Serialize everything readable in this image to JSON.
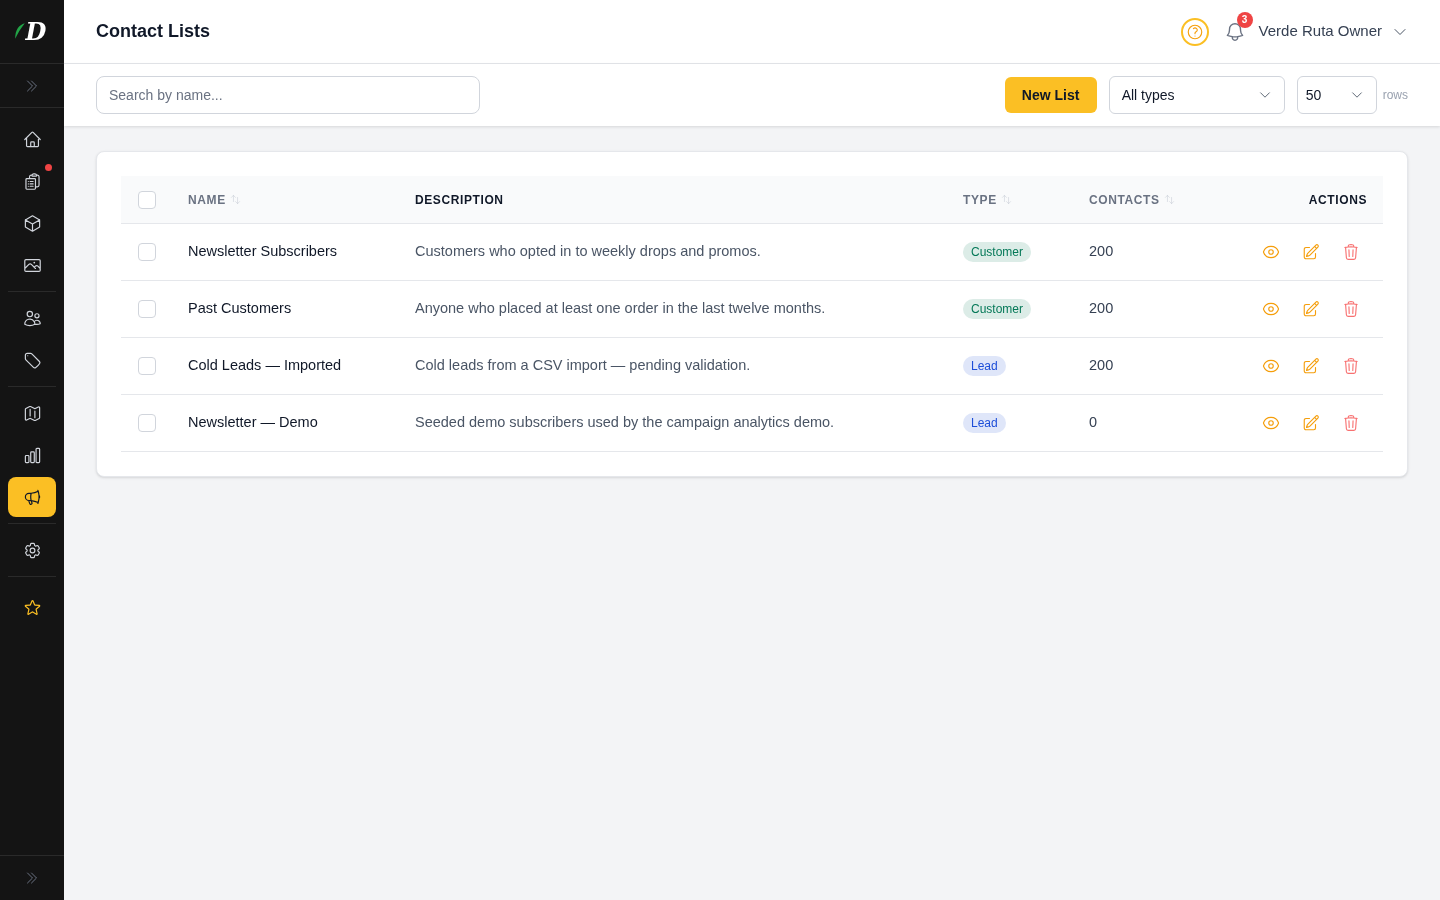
{
  "sidebar": {
    "logo": {
      "text": "D"
    },
    "groups": [
      [
        {
          "selected": false,
          "alert": false
        },
        {
          "selected": false,
          "alert": true
        },
        {
          "selected": false,
          "alert": false
        },
        {
          "selected": false,
          "alert": false
        }
      ],
      [
        {
          "selected": false,
          "alert": false
        },
        {
          "selected": false,
          "alert": false
        }
      ],
      [
        {
          "selected": false,
          "alert": false
        },
        {
          "selected": false,
          "alert": false
        },
        {
          "selected": true,
          "alert": false
        }
      ],
      [
        {
          "selected": false,
          "alert": false
        }
      ],
      [
        {
          "selected": false,
          "alert": false
        }
      ]
    ]
  },
  "header": {
    "title": "Contact Lists",
    "notifications": "3",
    "user": "Verde Ruta Owner"
  },
  "toolbar": {
    "search": {
      "placeholder": "Search by name..."
    },
    "new_button": "New List",
    "type_filter": {
      "value": "All types"
    },
    "page_size": {
      "value": "50"
    },
    "page_size_label": "rows"
  },
  "table": {
    "select_all": {
      "checked": false
    },
    "columns": [
      {
        "label": "NAME",
        "sortable": true
      },
      {
        "label": "DESCRIPTION",
        "sortable": false
      },
      {
        "label": "TYPE",
        "sortable": true
      },
      {
        "label": "CONTACTS",
        "sortable": true
      },
      {
        "label": "ACTIONS",
        "sortable": false
      }
    ],
    "rows": [
      {
        "checked": false,
        "name": "Newsletter Subscribers",
        "description": "Customers who opted in to weekly drops and promos.",
        "type": {
          "label": "Customer",
          "color": "#047857"
        },
        "contacts": "200"
      },
      {
        "checked": false,
        "name": "Past Customers",
        "description": "Anyone who placed at least one order in the last twelve months.",
        "type": {
          "label": "Customer",
          "color": "#047857"
        },
        "contacts": "200"
      },
      {
        "checked": false,
        "name": "Cold Leads — Imported",
        "description": "Cold leads from a CSV import — pending validation.",
        "type": {
          "label": "Lead",
          "color": "#1d4ed8"
        },
        "contacts": "200"
      },
      {
        "checked": false,
        "name": "Newsletter — Demo",
        "description": "Seeded demo subscribers used by the campaign analytics demo.",
        "type": {
          "label": "Lead",
          "color": "#1d4ed8"
        },
        "contacts": "0"
      }
    ]
  }
}
